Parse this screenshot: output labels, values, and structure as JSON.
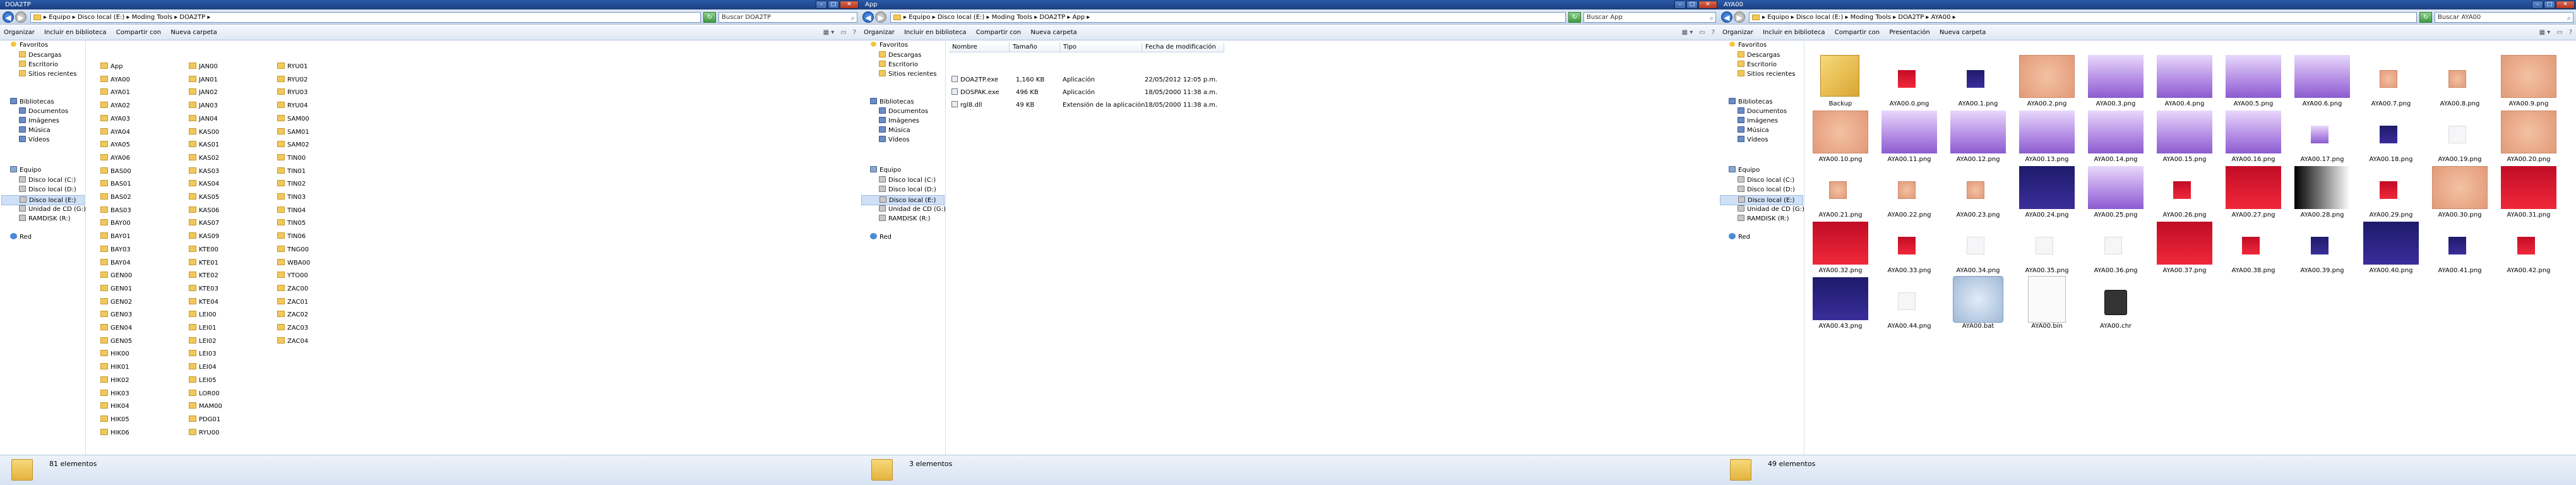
{
  "windows": [
    {
      "title": "DOA2TP",
      "address": "▸ Equipo ▸ Disco local (E:) ▸ Moding Tools ▸ DOA2TP ▸",
      "search_placeholder": "Buscar DOA2TP",
      "toolbar": [
        "Organizar",
        "Incluir en biblioteca",
        "Compartir con",
        "Nueva carpeta"
      ],
      "status": "81 elementos",
      "folders": [
        [
          "App",
          "AYA00",
          "AYA01",
          "AYA02",
          "AYA03",
          "AYA04",
          "AYA05",
          "AYA06",
          "BAS00",
          "BAS01",
          "BAS02",
          "BAS03",
          "BAY00",
          "BAY01",
          "BAY03",
          "BAY04",
          "GEN00",
          "GEN01",
          "GEN02",
          "GEN03",
          "GEN04",
          "GEN05",
          "HIK00",
          "HIK01",
          "HIK02",
          "HIK03",
          "HIK04",
          "HIK05",
          "HIK06"
        ],
        [
          "JAN00",
          "JAN01",
          "JAN02",
          "JAN03",
          "JAN04",
          "KAS00",
          "KAS01",
          "KAS02",
          "KAS03",
          "KAS04",
          "KAS05",
          "KAS06",
          "KAS07",
          "KAS09",
          "KTE00",
          "KTE01",
          "KTE02",
          "KTE03",
          "KTE04",
          "LEI00",
          "LEI01",
          "LEI02",
          "LEI03",
          "LEI04",
          "LEI05",
          "LOR00",
          "MAM00",
          "PDG01",
          "RYU00"
        ],
        [
          "RYU01",
          "RYU02",
          "RYU03",
          "RYU04",
          "SAM00",
          "SAM01",
          "SAM02",
          "TIN00",
          "TIN01",
          "TIN02",
          "TIN03",
          "TIN04",
          "TIN05",
          "TIN06",
          "TNG00",
          "WBA00",
          "YTO00",
          "ZAC00",
          "ZAC01",
          "ZAC02",
          "ZAC03",
          "ZAC04"
        ]
      ]
    },
    {
      "title": "App",
      "address": "▸ Equipo ▸ Disco local (E:) ▸ Moding Tools ▸ DOA2TP ▸ App ▸",
      "search_placeholder": "Buscar App",
      "toolbar": [
        "Organizar",
        "Incluir en biblioteca",
        "Compartir con",
        "Nueva carpeta"
      ],
      "status": "3 elementos",
      "columns": [
        "Nombre",
        "Tamaño",
        "Tipo",
        "Fecha de modificación"
      ],
      "files": [
        {
          "name": "DOA2TP.exe",
          "size": "1,160 KB",
          "type": "Aplicación",
          "date": "22/05/2012 12:05 p.m."
        },
        {
          "name": "DOSPAK.exe",
          "size": "496 KB",
          "type": "Aplicación",
          "date": "18/05/2000 11:38 a.m."
        },
        {
          "name": "rgl8.dll",
          "size": "49 KB",
          "type": "Extensión de la aplicación",
          "date": "18/05/2000 11:38 a.m."
        }
      ]
    },
    {
      "title": "AYA00",
      "address": "▸ Equipo ▸ Disco local (E:) ▸ Moding Tools ▸ DOA2TP ▸ AYA00 ▸",
      "search_placeholder": "Buscar AYA00",
      "toolbar": [
        "Organizar",
        "Incluir en biblioteca",
        "Compartir con",
        "Presentación",
        "Nueva carpeta"
      ],
      "status": "49 elementos",
      "tiles": [
        "Backup",
        "AYA00.0.png",
        "AYA00.1.png",
        "AYA00.2.png",
        "AYA00.3.png",
        "AYA00.4.png",
        "AYA00.5.png",
        "AYA00.6.png",
        "AYA00.7.png",
        "AYA00.8.png",
        "AYA00.9.png",
        "AYA00.10.png",
        "AYA00.11.png",
        "AYA00.12.png",
        "AYA00.13.png",
        "AYA00.14.png",
        "AYA00.15.png",
        "AYA00.16.png",
        "AYA00.17.png",
        "AYA00.18.png",
        "AYA00.19.png",
        "AYA00.20.png",
        "AYA00.21.png",
        "AYA00.22.png",
        "AYA00.23.png",
        "AYA00.24.png",
        "AYA00.25.png",
        "AYA00.26.png",
        "AYA00.27.png",
        "AYA00.28.png",
        "AYA00.29.png",
        "AYA00.30.png",
        "AYA00.31.png",
        "AYA00.32.png",
        "AYA00.33.png",
        "AYA00.34.png",
        "AYA00.35.png",
        "AYA00.36.png",
        "AYA00.37.png",
        "AYA00.38.png",
        "AYA00.39.png",
        "AYA00.40.png",
        "AYA00.41.png",
        "AYA00.42.png",
        "AYA00.43.png",
        "AYA00.44.png",
        "AYA00.bat",
        "AYA00.bin",
        "AYA00.chr"
      ]
    }
  ],
  "nav_pane": [
    "Favoritos",
    "Descargas",
    "Escritorio",
    "Sitios recientes",
    "Bibliotecas",
    "Documentos",
    "Imágenes",
    "Música",
    "Vídeos",
    "Equipo",
    "Disco local (C:)",
    "Disco local (D:)",
    "Disco local (E:)",
    "Unidad de CD (G:)",
    "RAMDISK (R:)",
    "Red"
  ],
  "colors": {
    "title_bar": "#1c3f7f",
    "selection": "#cfe0f7",
    "folder": "#f2c75c"
  }
}
